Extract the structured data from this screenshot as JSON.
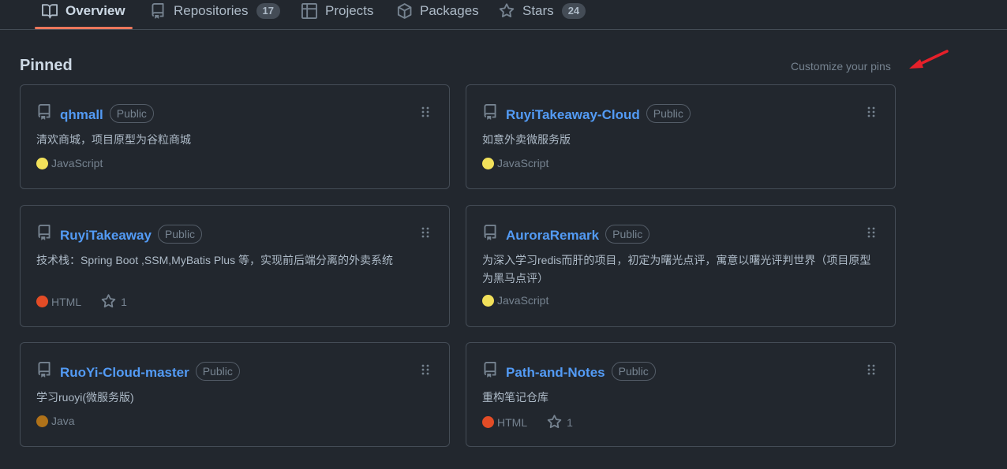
{
  "tabs": [
    {
      "label": "Overview",
      "count": null,
      "icon": "book-icon",
      "active": true
    },
    {
      "label": "Repositories",
      "count": "17",
      "icon": "repo-icon",
      "active": false
    },
    {
      "label": "Projects",
      "count": null,
      "icon": "table-icon",
      "active": false
    },
    {
      "label": "Packages",
      "count": null,
      "icon": "package-icon",
      "active": false
    },
    {
      "label": "Stars",
      "count": "24",
      "icon": "star-icon",
      "active": false
    }
  ],
  "pinned": {
    "title": "Pinned",
    "customize_label": "Customize your pins",
    "cards": [
      {
        "name": "qhmall",
        "visibility": "Public",
        "description": "清欢商城，项目原型为谷粒商城",
        "language": "JavaScript",
        "language_color": "#f1e05a",
        "stars": null
      },
      {
        "name": "RuyiTakeaway-Cloud",
        "visibility": "Public",
        "description": "如意外卖微服务版",
        "language": "JavaScript",
        "language_color": "#f1e05a",
        "stars": null
      },
      {
        "name": "RuyiTakeaway",
        "visibility": "Public",
        "description": "技术栈：Spring Boot ,SSM,MyBatis Plus 等，实现前后端分离的外卖系统",
        "language": "HTML",
        "language_color": "#e34c26",
        "stars": "1"
      },
      {
        "name": "AuroraRemark",
        "visibility": "Public",
        "description": "为深入学习redis而肝的项目，初定为曙光点评，寓意以曙光评判世界（项目原型为黑马点评）",
        "language": "JavaScript",
        "language_color": "#f1e05a",
        "stars": null
      },
      {
        "name": "RuoYi-Cloud-master",
        "visibility": "Public",
        "description": "学习ruoyi(微服务版)",
        "language": "Java",
        "language_color": "#b07219",
        "stars": null
      },
      {
        "name": "Path-and-Notes",
        "visibility": "Public",
        "description": "重构笔记仓库",
        "language": "HTML",
        "language_color": "#e34c26",
        "stars": "1"
      }
    ]
  },
  "colors": {
    "background": "#22272e",
    "border": "#444c56",
    "link": "#539bf5",
    "active_tab_underline": "#ec775c",
    "annotation_arrow": "#e5202a"
  }
}
